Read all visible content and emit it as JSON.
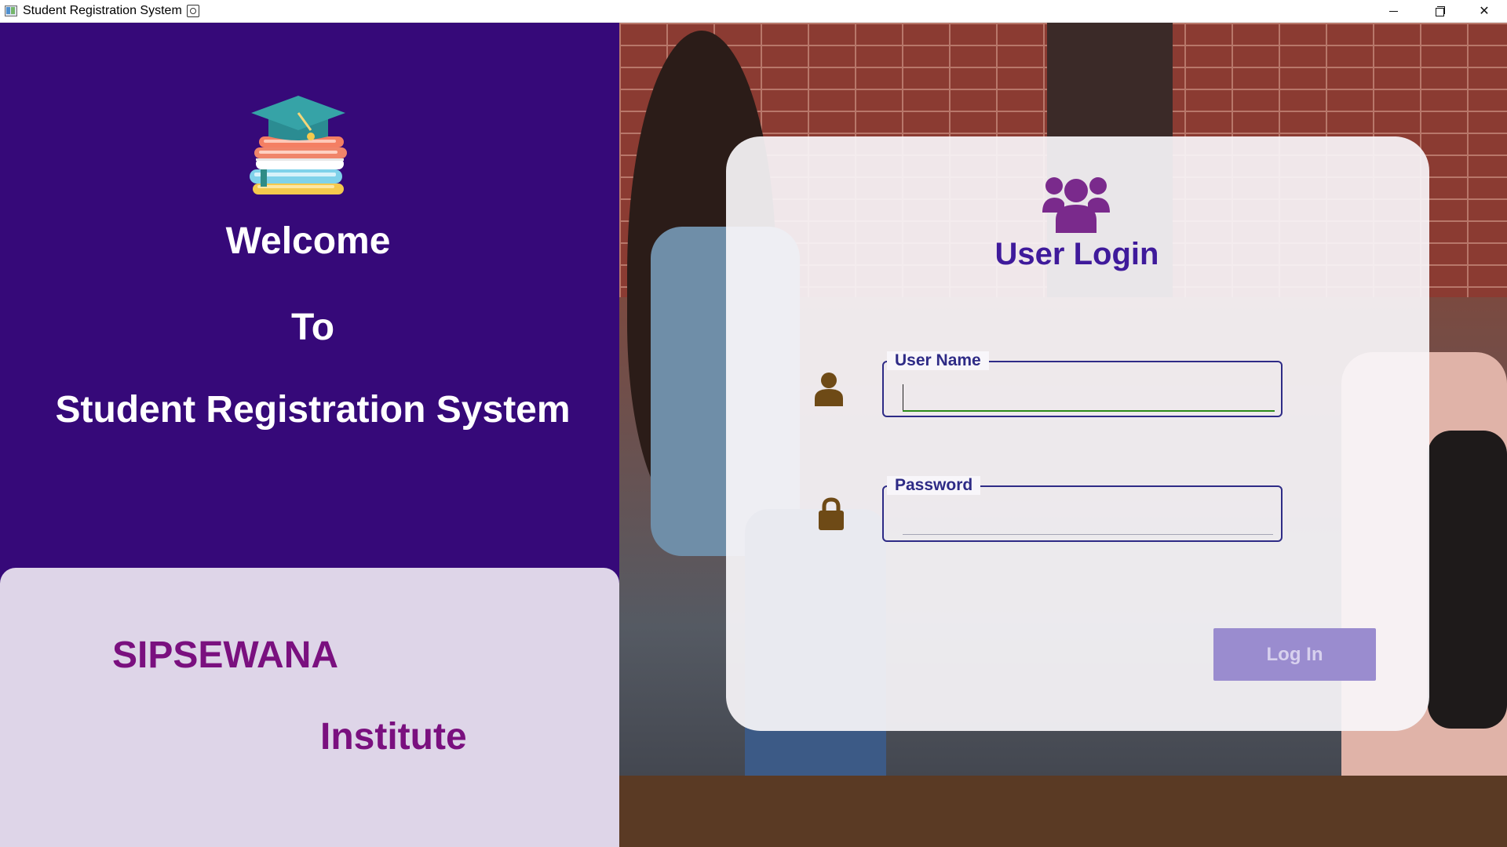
{
  "window": {
    "title": "Student Registration System",
    "controls": [
      "minimize",
      "restore",
      "close"
    ],
    "close_glyph": "✕"
  },
  "left_panel": {
    "background": "#360979",
    "logo_icon": "graduation-cap-books-icon",
    "welcome": "Welcome",
    "to": "To",
    "system_name": "Student Registration System",
    "institute_line1": "SIPSEWANA",
    "institute_line2": "Institute",
    "institute_color": "#7a107f",
    "card_background": "#ded5e8"
  },
  "login": {
    "icon": "users-group-icon",
    "title": "User Login",
    "title_color": "#3f1a9b",
    "username": {
      "icon": "user-icon",
      "legend": "User Name",
      "value": ""
    },
    "password": {
      "icon": "lock-icon",
      "legend": "Password",
      "value": ""
    },
    "button_label": "Log In",
    "button_color": "#9a8ccf"
  }
}
